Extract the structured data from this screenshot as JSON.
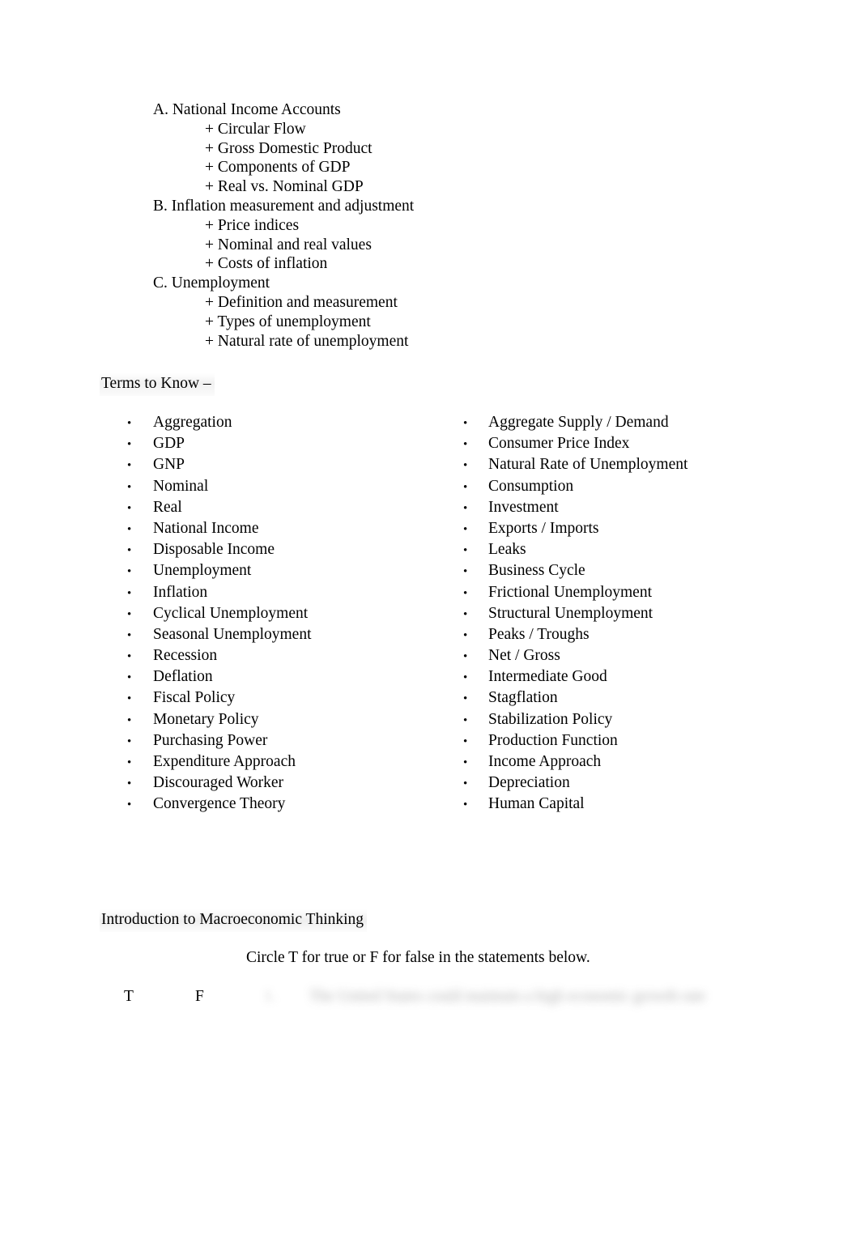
{
  "document": {
    "background_color": "#ffffff",
    "text_color": "#000000",
    "highlight_color": "#eeeeee"
  },
  "outline": {
    "rows": [
      {
        "text": "A. National Income Accounts",
        "level": "top"
      },
      {
        "text": "+ Circular Flow",
        "level": "sub"
      },
      {
        "text": "+ Gross Domestic Product",
        "level": "sub"
      },
      {
        "text": "+ Components of GDP",
        "level": "sub"
      },
      {
        "text": "+ Real vs. Nominal GDP",
        "level": "sub"
      },
      {
        "text": "B. Inflation measurement and adjustment",
        "level": "top"
      },
      {
        "text": "+ Price indices",
        "level": "sub"
      },
      {
        "text": "+ Nominal and real values",
        "level": "sub"
      },
      {
        "text": "+ Costs of inflation",
        "level": "sub"
      },
      {
        "text": "C. Unemployment",
        "level": "top"
      },
      {
        "text": "+ Definition and measurement",
        "level": "sub"
      },
      {
        "text": "+ Types of unemployment",
        "level": "sub"
      },
      {
        "text": "+ Natural rate of unemployment",
        "level": "sub"
      }
    ]
  },
  "terms": {
    "heading": "Terms to Know –",
    "bullet_glyph": "•",
    "left_column": [
      "Aggregation",
      "GDP",
      "GNP",
      "Nominal",
      "Real",
      "National Income",
      "Disposable Income",
      "Unemployment",
      "Inflation",
      "Cyclical Unemployment",
      "Seasonal Unemployment",
      "Recession",
      "Deflation",
      "Fiscal Policy",
      "Monetary Policy",
      "Purchasing Power",
      "Expenditure Approach",
      "Discouraged Worker",
      "Convergence Theory"
    ],
    "right_column": [
      "Aggregate Supply / Demand",
      "Consumer Price Index",
      "Natural Rate of Unemployment",
      "Consumption",
      "Investment",
      "Exports / Imports",
      "Leaks",
      "Business Cycle",
      "Frictional Unemployment",
      "Structural Unemployment",
      "Peaks / Troughs",
      "Net / Gross",
      "Intermediate Good",
      "Stagflation",
      "Stabilization Policy",
      "Production Function",
      "Income Approach",
      "Depreciation",
      "Human Capital"
    ]
  },
  "quiz": {
    "section_heading": "Introduction to Macroeconomic Thinking",
    "instruction": "Circle T for true or F for false in the statements below.",
    "true_label": "T",
    "false_label": "F",
    "first_question_number": "1.",
    "first_question_text": "The United States could maintain a high economic growth rate"
  }
}
